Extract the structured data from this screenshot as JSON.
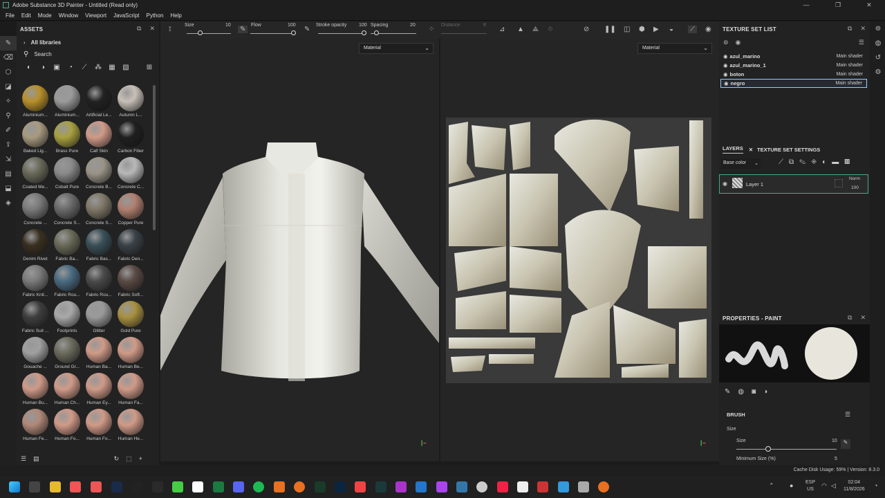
{
  "window": {
    "title": "Adobe Substance 3D Painter - Untitled (Read only)",
    "app_icon": "Pt"
  },
  "menu": [
    "File",
    "Edit",
    "Mode",
    "Window",
    "Viewport",
    "JavaScript",
    "Python",
    "Help"
  ],
  "assets": {
    "title": "ASSETS",
    "library": "All libraries",
    "search_placeholder": "Search",
    "items": [
      {
        "label": "Aluminium...",
        "color": "#b8902a"
      },
      {
        "label": "Aluminium...",
        "color": "#9a9a9a"
      },
      {
        "label": "Artificial Le...",
        "color": "#222222"
      },
      {
        "label": "Autumn L...",
        "color": "#c8c0b8"
      },
      {
        "label": "Baked Lig...",
        "color": "#a89a80"
      },
      {
        "label": "Brass Pure",
        "color": "#a8a040"
      },
      {
        "label": "Calf Skin",
        "color": "#d09a88"
      },
      {
        "label": "Carbon Fiber",
        "color": "#202020"
      },
      {
        "label": "Coated Me...",
        "color": "#6a6a5a"
      },
      {
        "label": "Cobalt Pure",
        "color": "#8a8a8a"
      },
      {
        "label": "Concrete B...",
        "color": "#9a9488"
      },
      {
        "label": "Concrete C...",
        "color": "#b8b8b8"
      },
      {
        "label": "Concrete ...",
        "color": "#7a7a7a"
      },
      {
        "label": "Concrete S...",
        "color": "#6a6a6a"
      },
      {
        "label": "Concrete S...",
        "color": "#807868"
      },
      {
        "label": "Copper Pure",
        "color": "#b08070"
      },
      {
        "label": "Denim Rivet",
        "color": "#3a3020"
      },
      {
        "label": "Fabric Ba...",
        "color": "#6a6a58"
      },
      {
        "label": "Fabric Bas...",
        "color": "#3a5058"
      },
      {
        "label": "Fabric Den...",
        "color": "#3a4248"
      },
      {
        "label": "Fabric Knit...",
        "color": "#7a7a7a"
      },
      {
        "label": "Fabric Rou...",
        "color": "#4a6a80"
      },
      {
        "label": "Fabric Rou...",
        "color": "#4a4a4a"
      },
      {
        "label": "Fabric Soft...",
        "color": "#5a4a44"
      },
      {
        "label": "Fabric Suit ...",
        "color": "#3e3e3e"
      },
      {
        "label": "Footprints",
        "color": "#a8a8a8"
      },
      {
        "label": "Glitter",
        "color": "#9a9a9a"
      },
      {
        "label": "Gold Pure",
        "color": "#a89040"
      },
      {
        "label": "Gouache ...",
        "color": "#a0a0a0"
      },
      {
        "label": "Ground Gr...",
        "color": "#6a6a5c"
      },
      {
        "label": "Human Ba...",
        "color": "#d09a88"
      },
      {
        "label": "Human Be...",
        "color": "#d09a88"
      },
      {
        "label": "Human Bu...",
        "color": "#d09a88"
      },
      {
        "label": "Human Ch...",
        "color": "#d09a88"
      },
      {
        "label": "Human Ey...",
        "color": "#d09a88"
      },
      {
        "label": "Human Fa...",
        "color": "#d09a88"
      },
      {
        "label": "Human Fe...",
        "color": "#b08878"
      },
      {
        "label": "Human Fo...",
        "color": "#d09a88"
      },
      {
        "label": "Human Fo...",
        "color": "#d09a88"
      },
      {
        "label": "Human He...",
        "color": "#d09a88"
      }
    ]
  },
  "toolbar": {
    "size_label": "Size",
    "size_value": "10",
    "flow_label": "Flow",
    "flow_value": "100",
    "stroke_label": "Stroke opacity",
    "stroke_value": "100",
    "spacing_label": "Spacing",
    "spacing_value": "20",
    "distance_label": "Distance",
    "distance_value": "8"
  },
  "viewport": {
    "mode_left": "Material",
    "mode_right": "Material"
  },
  "texture_sets": {
    "title": "TEXTURE SET LIST",
    "items": [
      {
        "name": "azul_marino",
        "shader": "Main shader"
      },
      {
        "name": "azul_marino_1",
        "shader": "Main shader"
      },
      {
        "name": "boton",
        "shader": "Main shader"
      },
      {
        "name": "negro",
        "shader": "Main shader"
      }
    ]
  },
  "layers": {
    "tab_layers": "LAYERS",
    "tab_settings": "TEXTURE SET SETTINGS",
    "channel": "Base color",
    "layer_name": "Layer 1",
    "blend": "Norm",
    "opacity": "100"
  },
  "properties": {
    "title": "PROPERTIES - PAINT",
    "section": "BRUSH",
    "size_header": "Size",
    "size_label": "Size",
    "size_value": "10",
    "min_size_label": "Minimum Size (%)",
    "min_size_value": "5"
  },
  "status": {
    "text": "Cache Disk Usage:   59% | Version: 8.3.0"
  },
  "taskbar": {
    "lang": "ESP",
    "region": "US",
    "time": "02:04",
    "date": "11/8/2026"
  }
}
